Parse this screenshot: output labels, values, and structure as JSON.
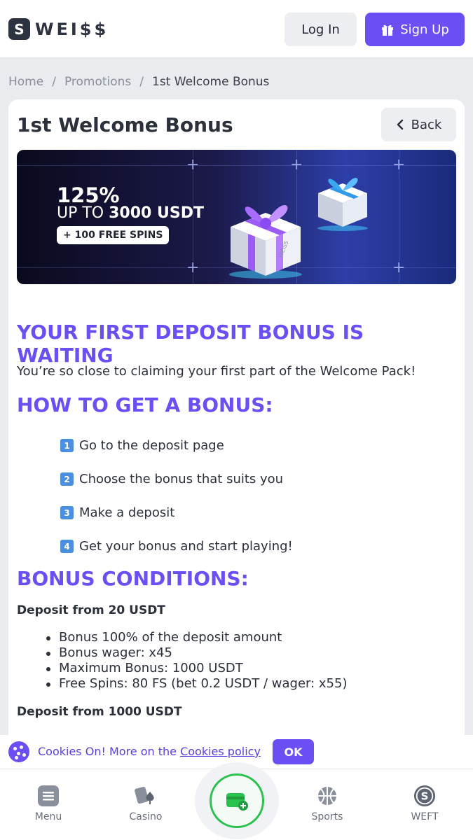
{
  "header": {
    "logo_mark": "S",
    "logo_text": "WEI$$",
    "login_label": "Log In",
    "signup_label": "Sign Up"
  },
  "breadcrumb": {
    "items": [
      "Home",
      "Promotions",
      "1st Welcome Bonus"
    ],
    "separator": "/"
  },
  "page": {
    "title": "1st Welcome Bonus",
    "back_label": "Back"
  },
  "banner": {
    "percent": "125%",
    "upto_prefix": "UP TO ",
    "upto_amount": "3000 USDT",
    "spins": "+ 100 FREE SPINS",
    "gift_brand": "WEISS"
  },
  "content": {
    "heading_main": "YOUR FIRST DEPOSIT BONUS IS WAITING",
    "intro": "You’re so close to claiming your first part of the Welcome Pack!",
    "heading_how": "HOW TO GET A BONUS:",
    "steps": [
      {
        "num": "1",
        "text": "Go to the deposit page"
      },
      {
        "num": "2",
        "text": "Choose the bonus that suits you"
      },
      {
        "num": "3",
        "text": "Make a deposit"
      },
      {
        "num": "4",
        "text": "Get your bonus and start playing!"
      }
    ],
    "heading_conditions": "BONUS CONDITIONS:",
    "tier1_title": "Deposit from 20 USDT",
    "tier1_items": [
      "Bonus 100% of the deposit amount",
      "Bonus wager: x45",
      "Maximum Bonus: 1000 USDT",
      "Free Spins: 80 FS (bet 0.2 USDT / wager: x55)"
    ],
    "tier2_title": "Deposit from 1000 USDT"
  },
  "cookie": {
    "text": "Cookies On! More on the ",
    "link": "Cookies policy",
    "ok_label": "OK"
  },
  "bottom_nav": {
    "menu": "Menu",
    "casino": "Casino",
    "sports": "Sports",
    "weft": "WEFT"
  },
  "colors": {
    "accent": "#6b4ff5",
    "green": "#29c24f"
  }
}
